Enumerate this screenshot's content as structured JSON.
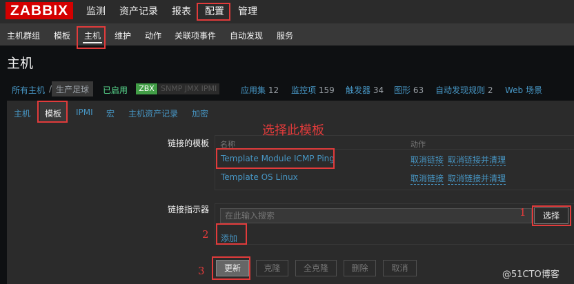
{
  "topnav": {
    "logo": "ZABBIX",
    "items": [
      "监测",
      "资产记录",
      "报表",
      "配置",
      "管理"
    ]
  },
  "subnav": {
    "items": [
      "主机群组",
      "模板",
      "主机",
      "维护",
      "动作",
      "关联项事件",
      "自动发现",
      "服务"
    ]
  },
  "page_title": "主机",
  "breadcrumb": {
    "all_hosts": "所有主机",
    "sep": "/",
    "current": "生产足球",
    "status": "已启用",
    "availability": {
      "zbx": "ZBX",
      "rest": "SNMP JMX IPMI"
    },
    "counts": [
      {
        "label": "应用集",
        "count": "12"
      },
      {
        "label": "监控项",
        "count": "159"
      },
      {
        "label": "触发器",
        "count": "34"
      },
      {
        "label": "图形",
        "count": "63"
      },
      {
        "label": "自动发现规则",
        "count": "2"
      },
      {
        "label": "Web 场景",
        "count": ""
      }
    ]
  },
  "form_tabs": [
    "主机",
    "模板",
    "IPMI",
    "宏",
    "主机资产记录",
    "加密"
  ],
  "linked_templates": {
    "label": "链接的模板",
    "col_name": "名称",
    "col_action": "动作",
    "rows": [
      {
        "name": "Template Module ICMP Ping",
        "unlink": "取消链接",
        "unlink_clear": "取消链接并清理"
      },
      {
        "name": "Template OS Linux",
        "unlink": "取消链接",
        "unlink_clear": "取消链接并清理"
      }
    ]
  },
  "link_indicator": {
    "label": "链接指示器",
    "placeholder": "在此输入搜索",
    "select_label": "选择",
    "add_label": "添加"
  },
  "buttons": {
    "update": "更新",
    "clone": "克隆",
    "full_clone": "全克隆",
    "delete": "删除",
    "cancel": "取消"
  },
  "annotations": {
    "title": "选择此模板",
    "num1": "1",
    "num2": "2",
    "num3": "3",
    "color": "#e23b3b"
  },
  "watermark": "@51CTO博客"
}
